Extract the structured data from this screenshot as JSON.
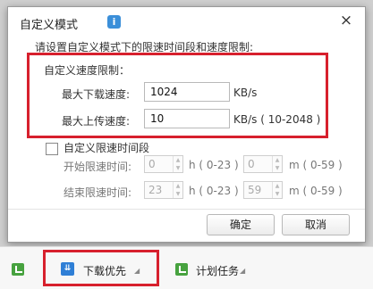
{
  "dialog": {
    "title": "自定义模式",
    "info_icon": "i",
    "close_icon": "×",
    "instruction": "请设置自定义模式下的限速时间段和速度限制:",
    "speed_section_label": "自定义速度限制：",
    "download_label": "最大下载速度:",
    "download_value": "1024",
    "download_unit": "KB/s",
    "upload_label": "最大上传速度:",
    "upload_value": "10",
    "upload_unit": "KB/s ( 10-2048 )",
    "time_limit_label": "自定义限速时间段",
    "time_limit_checked": false,
    "start_label": "开始限速时间:",
    "start_hour": "0",
    "start_hour_range": "h ( 0-23 )",
    "start_minute": "0",
    "start_minute_range": "m ( 0-59 )",
    "end_label": "结束限速时间:",
    "end_hour": "23",
    "end_hour_range": "h ( 0-23 )",
    "end_minute": "59",
    "end_minute_range": "m ( 0-59 )",
    "ok_label": "确定",
    "cancel_label": "取消"
  },
  "bottombar": {
    "download_priority_label": "下载优先",
    "scheduled_task_label": "计划任务"
  },
  "colors": {
    "highlight": "#d7202d",
    "accent_blue": "#2f7fd6",
    "green": "#47a23f"
  }
}
